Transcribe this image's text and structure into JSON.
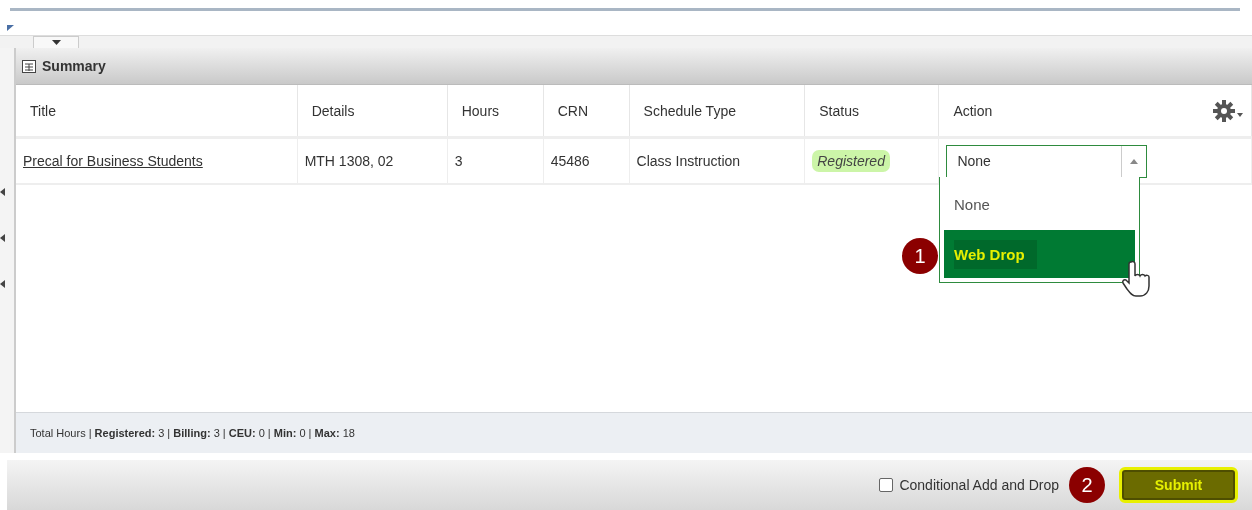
{
  "panel": {
    "title": "Summary"
  },
  "table": {
    "columns": [
      "Title",
      "Details",
      "Hours",
      "CRN",
      "Schedule Type",
      "Status",
      "Action"
    ],
    "rows": [
      {
        "title": "Precal for Business Students",
        "details": "MTH 1308, 02",
        "hours": "3",
        "crn": "45486",
        "schedule_type": "Class Instruction",
        "status": "Registered",
        "action": {
          "value": "None",
          "expanded": true,
          "options": [
            {
              "label": "None",
              "highlighted": false
            },
            {
              "label": "Web Drop",
              "highlighted": true
            }
          ]
        }
      }
    ]
  },
  "totals": "Total Hours | **Registered:** 3 | **Billing:** 3 | **CEU:** 0 | **Min:** 0 | **Max:** 18",
  "conditional": {
    "label": "Conditional Add and Drop",
    "checked": false
  },
  "submit": {
    "label": "Submit"
  },
  "step_markers": [
    "1",
    "2"
  ]
}
